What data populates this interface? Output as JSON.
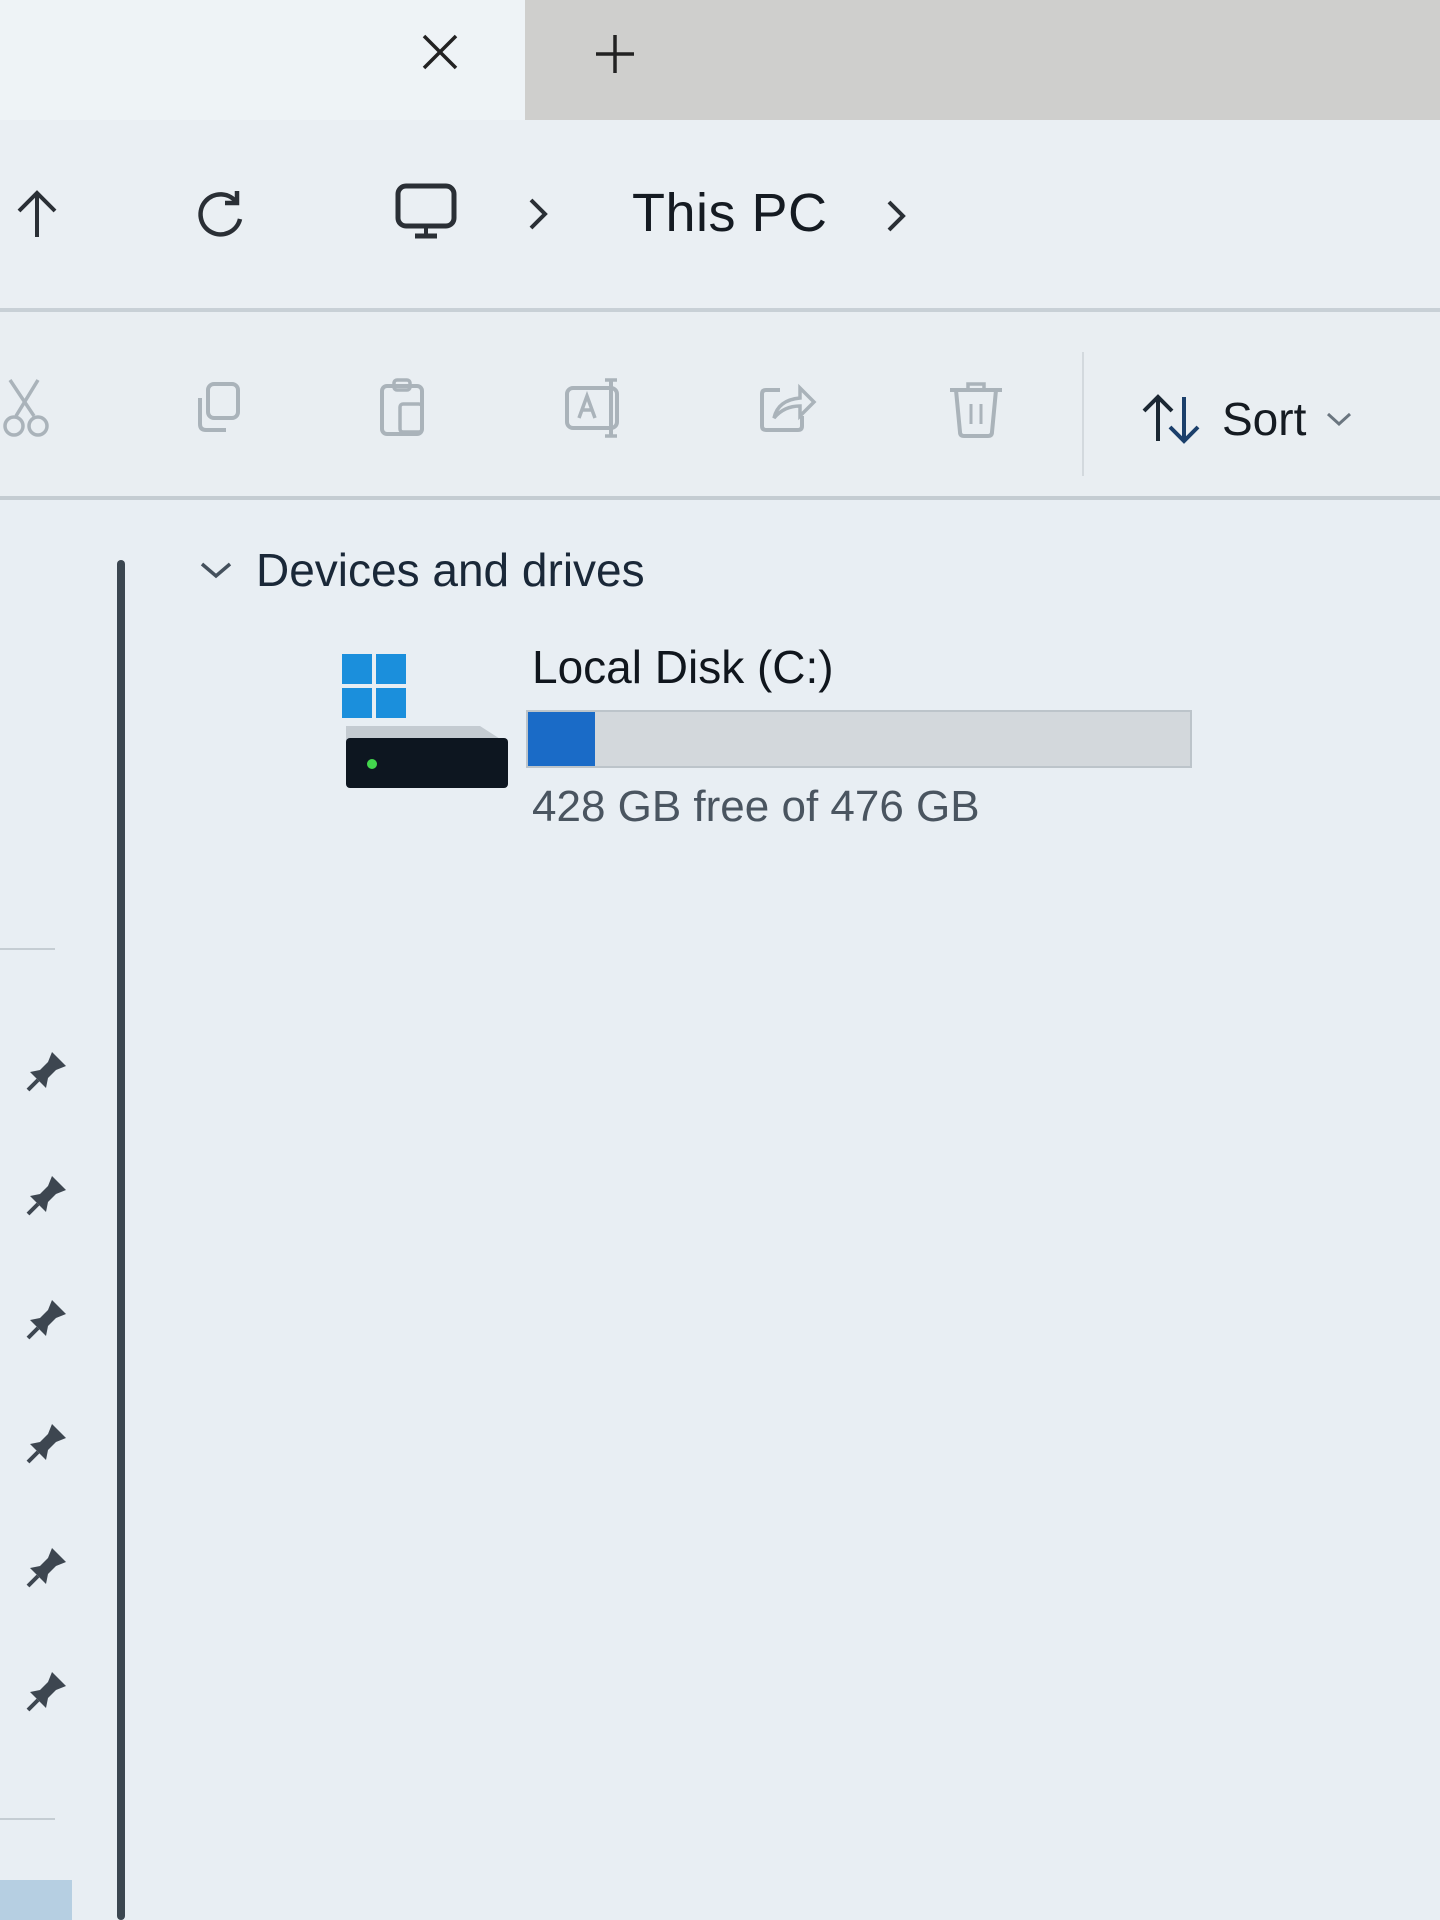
{
  "tabs": {
    "close_icon": "close-icon",
    "new_tab_icon": "plus-icon"
  },
  "address_bar": {
    "breadcrumb": [
      "This PC"
    ],
    "location_icon": "monitor-icon"
  },
  "command_bar": {
    "buttons": [
      "cut-icon",
      "copy-icon",
      "paste-icon",
      "rename-icon",
      "share-icon",
      "delete-icon"
    ],
    "sort_label": "Sort"
  },
  "content": {
    "section_label": "Devices and drives",
    "drives": [
      {
        "name": "Local Disk (C:)",
        "free_text": "428 GB free of 476 GB",
        "used_fraction": 0.1008
      }
    ]
  },
  "nav_pane": {
    "pinned_count": 6
  },
  "colors": {
    "accent": "#1a6bc7",
    "background": "#e8eef3",
    "inactive_tab": "#cfcfcd"
  }
}
